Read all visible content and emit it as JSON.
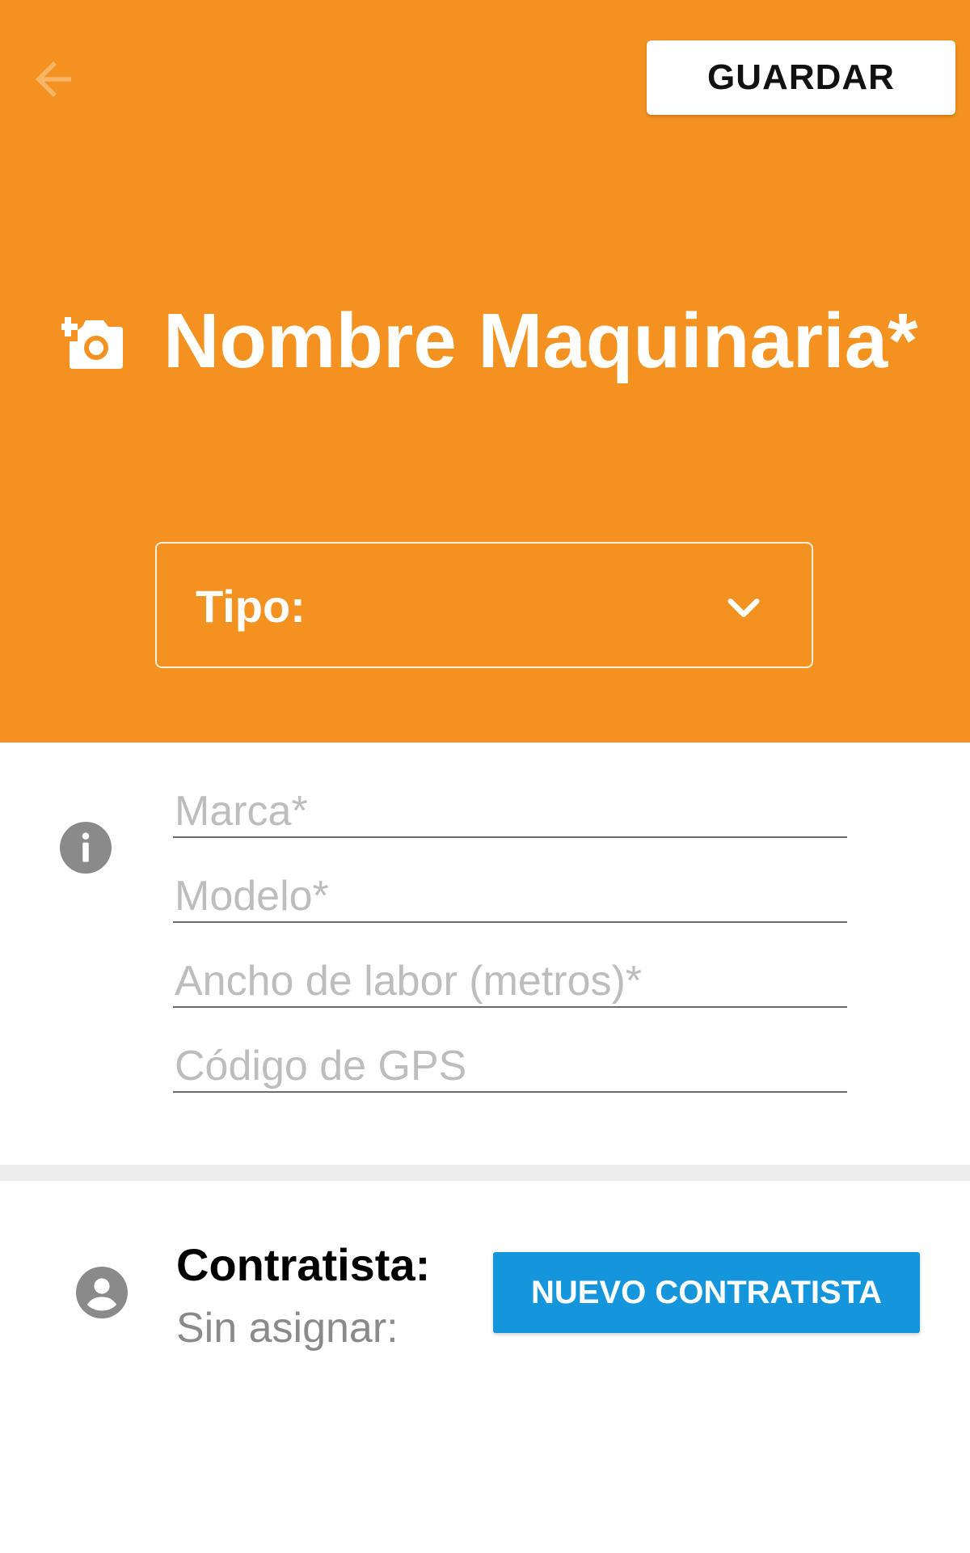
{
  "header": {
    "back_icon": "arrow-left-icon",
    "save_label": "GUARDAR",
    "add_photo_icon": "add-photo-camera-icon",
    "title": "Nombre Maquinaria*",
    "type_select": {
      "label": "Tipo:",
      "icon": "chevron-down-icon"
    },
    "background_color": "#f39220"
  },
  "form": {
    "info_icon": "info-icon",
    "fields": [
      {
        "placeholder": "Marca*",
        "value": ""
      },
      {
        "placeholder": "Modelo*",
        "value": ""
      },
      {
        "placeholder": "Ancho de labor (metros)*",
        "value": ""
      },
      {
        "placeholder": "Código de GPS",
        "value": ""
      }
    ]
  },
  "contractor": {
    "icon": "account-circle-icon",
    "label": "Contratista:",
    "value": "Sin asignar:",
    "new_button_label": "NUEVO CONTRATISTA",
    "button_color": "#1596dc"
  }
}
